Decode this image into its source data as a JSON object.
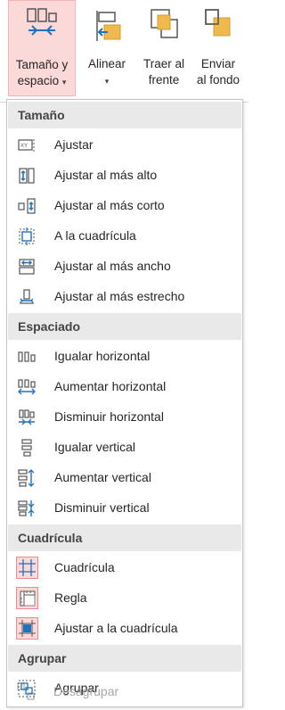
{
  "ribbon": {
    "size_label_1": "Tamaño y",
    "size_label_2": "espacio",
    "align_label": "Alinear",
    "bring_front_1": "Traer al",
    "bring_front_2": "frente",
    "send_back_1": "Enviar",
    "send_back_2": "al fondo",
    "caret": "▾"
  },
  "menu": {
    "sections": {
      "size": "Tamaño",
      "spacing": "Espaciado",
      "grid": "Cuadrícula",
      "group": "Agrupar"
    },
    "items": {
      "fit": "Ajustar",
      "fit_tallest": "Ajustar al más alto",
      "fit_shortest": "Ajustar al más corto",
      "to_grid": "A la cuadrícula",
      "fit_widest": "Ajustar al más ancho",
      "fit_narrowest": "Ajustar al más estrecho",
      "equal_horizontal": "Igualar horizontal",
      "increase_horizontal": "Aumentar horizontal",
      "decrease_horizontal": "Disminuir horizontal",
      "equal_vertical": "Igualar vertical",
      "increase_vertical": "Aumentar vertical",
      "decrease_vertical": "Disminuir vertical",
      "grid": "Cuadrícula",
      "ruler": "Regla",
      "snap_to_grid": "Ajustar a la cuadrícula",
      "group": "Agrupar",
      "ungroup": "Desagrupar"
    }
  },
  "colors": {
    "icon_blue": "#2b579a",
    "icon_accent_blue": "#1e73be",
    "checked_bg": "#fbd9d9",
    "checked_border": "#f08a8a",
    "section_bg": "#e9e9e9",
    "folder_orange": "#f0b94d"
  }
}
